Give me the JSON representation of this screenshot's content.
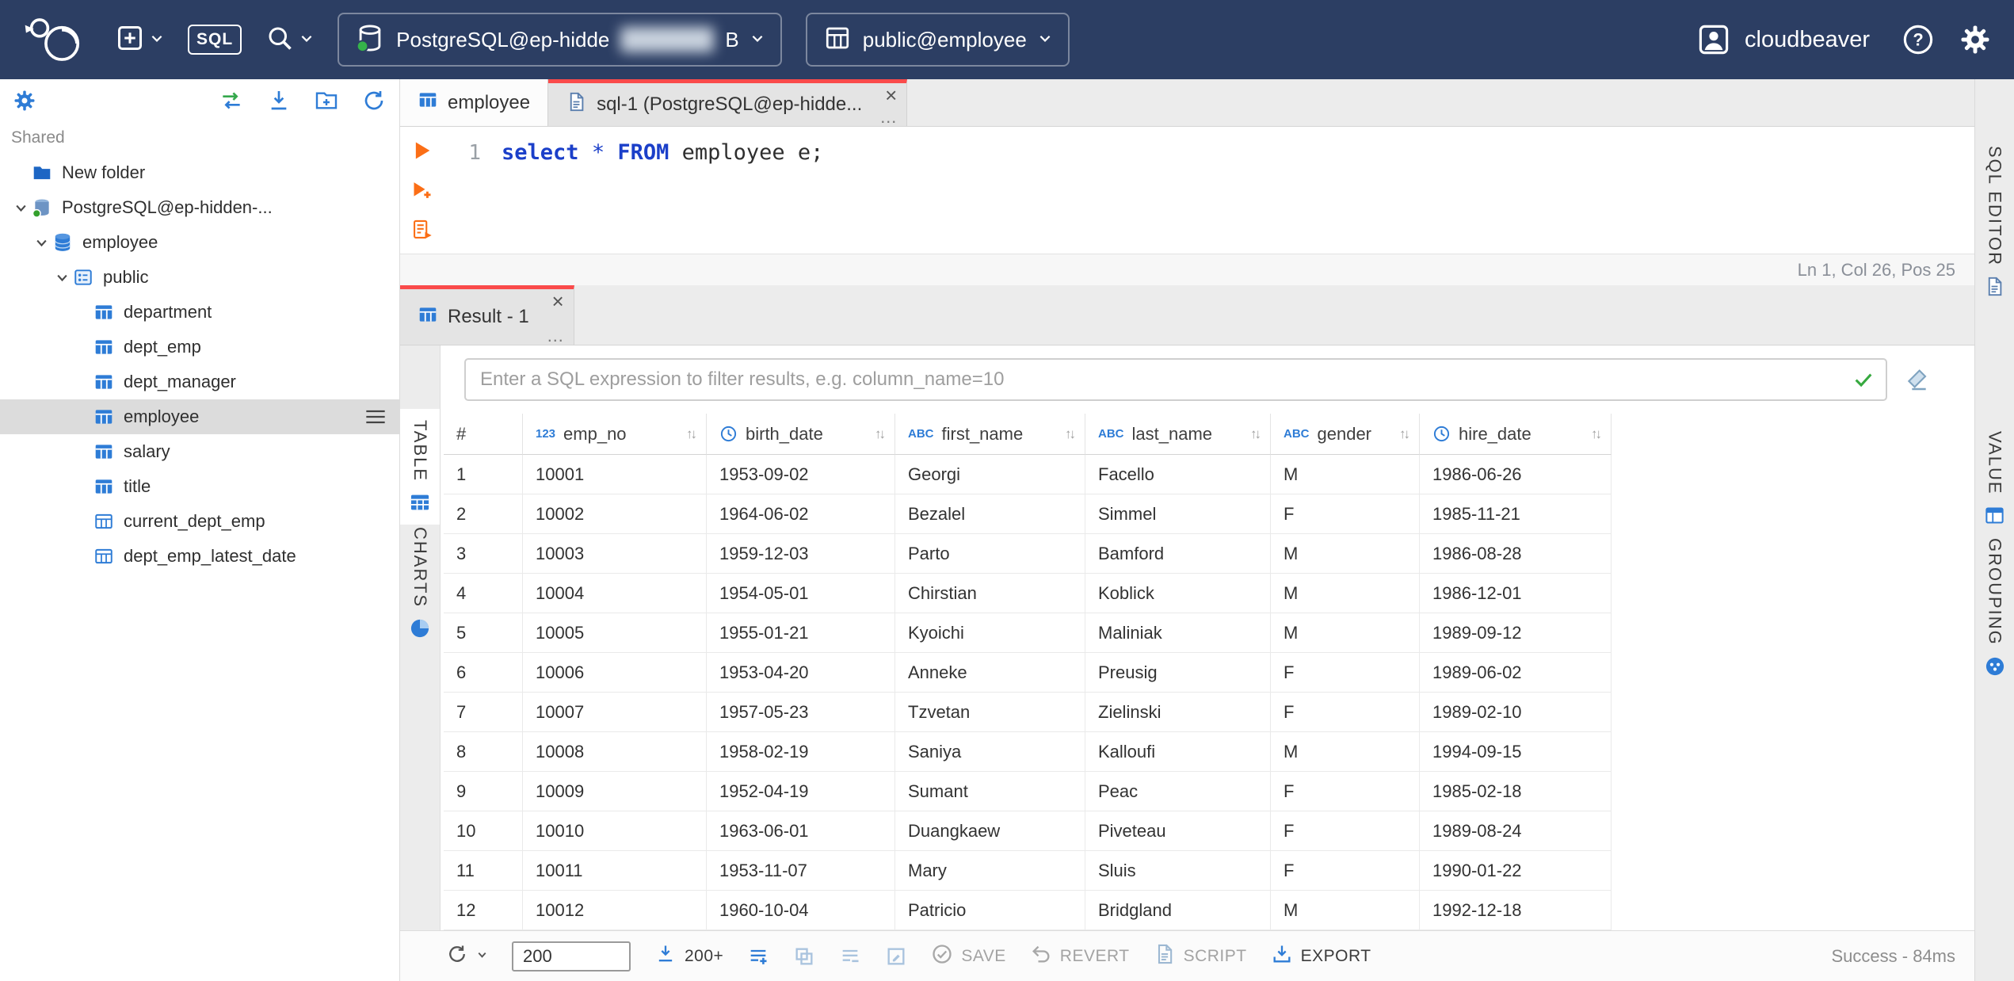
{
  "colors": {
    "topbar_bg": "#2c3e63",
    "accent_red": "#fa4b4b",
    "icon_blue": "#2e7cd6",
    "exec_orange": "#fb6e16",
    "success_green": "#36a93f"
  },
  "icons": {
    "close": "×",
    "menu_dots": "…",
    "sort": "↑↓"
  },
  "topbar": {
    "brand": "cloudbeaver",
    "sql_badge": "SQL",
    "connection_selector": {
      "visible_text": "PostgreSQL@ep-hidde",
      "redacted_middle": true,
      "visible_suffix": "B"
    },
    "schema_selector": {
      "label": "public@employee"
    }
  },
  "sidebar": {
    "section_label": "Shared",
    "tree": [
      {
        "label": "New folder",
        "level": 0,
        "icon": "folder"
      },
      {
        "label": "PostgreSQL@ep-hidden-...",
        "level": 0,
        "icon": "connection",
        "expanded": true
      },
      {
        "label": "employee",
        "level": 1,
        "icon": "database",
        "expanded": true
      },
      {
        "label": "public",
        "level": 2,
        "icon": "schema",
        "expanded": true
      },
      {
        "label": "department",
        "level": 3,
        "icon": "table"
      },
      {
        "label": "dept_emp",
        "level": 3,
        "icon": "table"
      },
      {
        "label": "dept_manager",
        "level": 3,
        "icon": "table"
      },
      {
        "label": "employee",
        "level": 3,
        "icon": "table",
        "selected": true
      },
      {
        "label": "salary",
        "level": 3,
        "icon": "table"
      },
      {
        "label": "title",
        "level": 3,
        "icon": "table"
      },
      {
        "label": "current_dept_emp",
        "level": 3,
        "icon": "view"
      },
      {
        "label": "dept_emp_latest_date",
        "level": 3,
        "icon": "view"
      }
    ]
  },
  "editor_tabs": [
    {
      "label": "employee",
      "icon": "table",
      "active": false,
      "closable": false
    },
    {
      "label": "sql-1 (PostgreSQL@ep-hidde...",
      "icon": "sqldoc",
      "active": true,
      "closable": true
    }
  ],
  "sql_editor": {
    "line_number": "1",
    "code_tokens": [
      {
        "text": "select",
        "type": "kw"
      },
      {
        "text": " ",
        "type": "plain"
      },
      {
        "text": "*",
        "type": "op"
      },
      {
        "text": " ",
        "type": "plain"
      },
      {
        "text": "FROM",
        "type": "kw"
      },
      {
        "text": " employee e;",
        "type": "plain"
      }
    ],
    "status": "Ln 1, Col 26, Pos 25",
    "rail_tab": {
      "label": "SQL EDITOR",
      "icon": "sqldoc"
    }
  },
  "results": {
    "tab": {
      "label": "Result - 1",
      "icon": "table",
      "active": true,
      "closable": true
    },
    "filter_placeholder": "Enter a SQL expression to filter results, e.g. column_name=10",
    "left_rail": [
      {
        "label": "TABLE",
        "icon": "tablegrid",
        "active": true
      },
      {
        "label": "CHARTS",
        "icon": "pie",
        "active": false
      }
    ],
    "right_rail": [
      {
        "label": "VALUE",
        "icon": "valuepanel"
      },
      {
        "label": "GROUPING",
        "icon": "grouping"
      }
    ],
    "grid": {
      "columns": [
        {
          "name": "#",
          "type": null,
          "sortable": false
        },
        {
          "name": "emp_no",
          "type": "number",
          "sortable": true
        },
        {
          "name": "birth_date",
          "type": "date",
          "sortable": true
        },
        {
          "name": "first_name",
          "type": "text",
          "sortable": true
        },
        {
          "name": "last_name",
          "type": "text",
          "sortable": true
        },
        {
          "name": "gender",
          "type": "text",
          "sortable": true
        },
        {
          "name": "hire_date",
          "type": "date",
          "sortable": true
        }
      ],
      "rows": [
        [
          "1",
          "10001",
          "1953-09-02",
          "Georgi",
          "Facello",
          "M",
          "1986-06-26"
        ],
        [
          "2",
          "10002",
          "1964-06-02",
          "Bezalel",
          "Simmel",
          "F",
          "1985-11-21"
        ],
        [
          "3",
          "10003",
          "1959-12-03",
          "Parto",
          "Bamford",
          "M",
          "1986-08-28"
        ],
        [
          "4",
          "10004",
          "1954-05-01",
          "Chirstian",
          "Koblick",
          "M",
          "1986-12-01"
        ],
        [
          "5",
          "10005",
          "1955-01-21",
          "Kyoichi",
          "Maliniak",
          "M",
          "1989-09-12"
        ],
        [
          "6",
          "10006",
          "1953-04-20",
          "Anneke",
          "Preusig",
          "F",
          "1989-06-02"
        ],
        [
          "7",
          "10007",
          "1957-05-23",
          "Tzvetan",
          "Zielinski",
          "F",
          "1989-02-10"
        ],
        [
          "8",
          "10008",
          "1958-02-19",
          "Saniya",
          "Kalloufi",
          "M",
          "1994-09-15"
        ],
        [
          "9",
          "10009",
          "1952-04-19",
          "Sumant",
          "Peac",
          "F",
          "1985-02-18"
        ],
        [
          "10",
          "10010",
          "1963-06-01",
          "Duangkaew",
          "Piveteau",
          "F",
          "1989-08-24"
        ],
        [
          "11",
          "10011",
          "1953-11-07",
          "Mary",
          "Sluis",
          "F",
          "1990-01-22"
        ],
        [
          "12",
          "10012",
          "1960-10-04",
          "Patricio",
          "Bridgland",
          "M",
          "1992-12-18"
        ]
      ]
    },
    "toolbar": {
      "page_size": "200",
      "fetch_label": "200+",
      "save_label": "SAVE",
      "revert_label": "REVERT",
      "script_label": "SCRIPT",
      "export_label": "EXPORT",
      "status": "Success - 84ms"
    }
  }
}
